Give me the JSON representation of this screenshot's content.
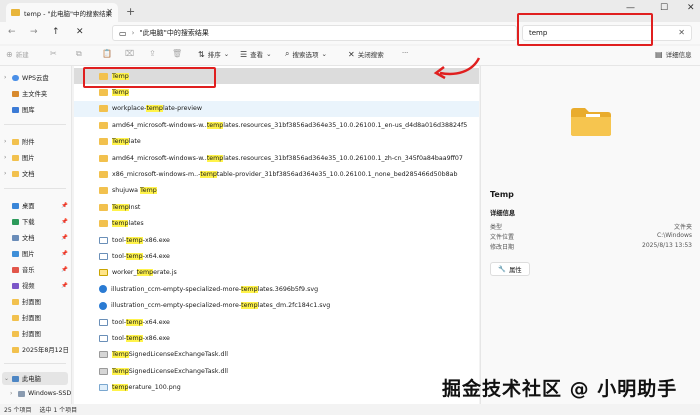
{
  "window": {
    "tab_title": "temp - \"此电脑\"中的搜索结果",
    "new_tab": "+",
    "minimize": "—",
    "maximize": "☐",
    "close": "✕"
  },
  "address": {
    "path": "\"此电脑\"中的搜索结果",
    "search_value": "temp"
  },
  "toolbar": {
    "new": "新建",
    "sort": "排序",
    "view": "查看",
    "search_options": "搜索选项",
    "close_search": "关闭搜索",
    "more": "···",
    "details": "详细信息"
  },
  "sidebar": {
    "items": [
      {
        "label": "WPS云盘",
        "icon": "cloud-icon"
      },
      {
        "label": "主文件夹",
        "icon": "home-icon"
      },
      {
        "label": "图库",
        "icon": "gallery-icon"
      },
      {
        "label": "附件",
        "icon": "folder-icon"
      },
      {
        "label": "图片",
        "icon": "folder-icon"
      },
      {
        "label": "文档",
        "icon": "folder-icon"
      },
      {
        "label": "桌面",
        "icon": "desktop-icon"
      },
      {
        "label": "下载",
        "icon": "download-icon"
      },
      {
        "label": "文档",
        "icon": "document-icon"
      },
      {
        "label": "图片",
        "icon": "picture-icon"
      },
      {
        "label": "音乐",
        "icon": "music-icon"
      },
      {
        "label": "视频",
        "icon": "video-icon"
      },
      {
        "label": "封面图",
        "icon": "folder-icon"
      },
      {
        "label": "封面图",
        "icon": "folder-icon"
      },
      {
        "label": "封面图",
        "icon": "folder-icon"
      },
      {
        "label": "2025年8月12日",
        "icon": "folder-icon"
      },
      {
        "label": "此电脑",
        "icon": "pc-icon"
      },
      {
        "label": "Windows-SSD",
        "icon": "drive-icon"
      }
    ]
  },
  "files": [
    {
      "pre": "",
      "hl": "Temp",
      "post": "",
      "type": "folder"
    },
    {
      "pre": "",
      "hl": "Temp",
      "post": "",
      "type": "folder"
    },
    {
      "pre": "workplace-",
      "hl": "temp",
      "post": "late-preview",
      "type": "folder"
    },
    {
      "pre": "amd64_microsoft-windows-w..",
      "hl": "temp",
      "post": "lates.resources_31bf3856ad364e35_10.0.26100.1_en-us_d4d8a016d38824f5",
      "type": "folder"
    },
    {
      "pre": "",
      "hl": "Temp",
      "post": "late",
      "type": "folder"
    },
    {
      "pre": "amd64_microsoft-windows-w..",
      "hl": "temp",
      "post": "lates.resources_31bf3856ad364e35_10.0.26100.1_zh-cn_345f0a84baa9ff07",
      "type": "folder"
    },
    {
      "pre": "x86_microsoft-windows-m..-",
      "hl": "temp",
      "post": "table-provider_31bf3856ad364e35_10.0.26100.1_none_bed285466d50b8ab",
      "type": "folder"
    },
    {
      "pre": "shujuwa ",
      "hl": "Temp",
      "post": "",
      "type": "folder"
    },
    {
      "pre": "",
      "hl": "Temp",
      "post": "Inst",
      "type": "folder"
    },
    {
      "pre": "",
      "hl": "temp",
      "post": "lates",
      "type": "folder"
    },
    {
      "pre": "tool-",
      "hl": "temp",
      "post": "-x86.exe",
      "type": "exe"
    },
    {
      "pre": "tool-",
      "hl": "temp",
      "post": "-x64.exe",
      "type": "exe"
    },
    {
      "pre": "worker_",
      "hl": "temp",
      "post": "erate.js",
      "type": "js"
    },
    {
      "pre": "illustration_ccm-empty-specialized-more-",
      "hl": "temp",
      "post": "lates.3696b5f9.svg",
      "type": "svg"
    },
    {
      "pre": "illustration_ccm-empty-specialized-more-",
      "hl": "temp",
      "post": "lates_dm.2fc184c1.svg",
      "type": "svg"
    },
    {
      "pre": "tool-",
      "hl": "temp",
      "post": "-x64.exe",
      "type": "exe"
    },
    {
      "pre": "tool-",
      "hl": "temp",
      "post": "-x86.exe",
      "type": "exe"
    },
    {
      "pre": "",
      "hl": "Temp",
      "post": "SignedLicenseExchangeTask.dll",
      "type": "dll"
    },
    {
      "pre": "",
      "hl": "Temp",
      "post": "SignedLicenseExchangeTask.dll",
      "type": "dll"
    },
    {
      "pre": "",
      "hl": "temp",
      "post": "erature_100.png",
      "type": "png"
    }
  ],
  "preview": {
    "title": "Temp",
    "section": "详细信息",
    "props": [
      {
        "key": "类型",
        "value": "文件夹"
      },
      {
        "key": "文件位置",
        "value": "C:\\Windows"
      },
      {
        "key": "修改日期",
        "value": "2025/8/13 13:53"
      }
    ],
    "properties_button": "属性"
  },
  "status": {
    "count": "25 个项目",
    "selected": "选中 1 个项目"
  },
  "watermark": "掘金技术社区 @ 小明助手",
  "colors": {
    "highlight": "#fff34a",
    "annotation_red": "#e01f1f",
    "folder": "#f2c14e"
  }
}
